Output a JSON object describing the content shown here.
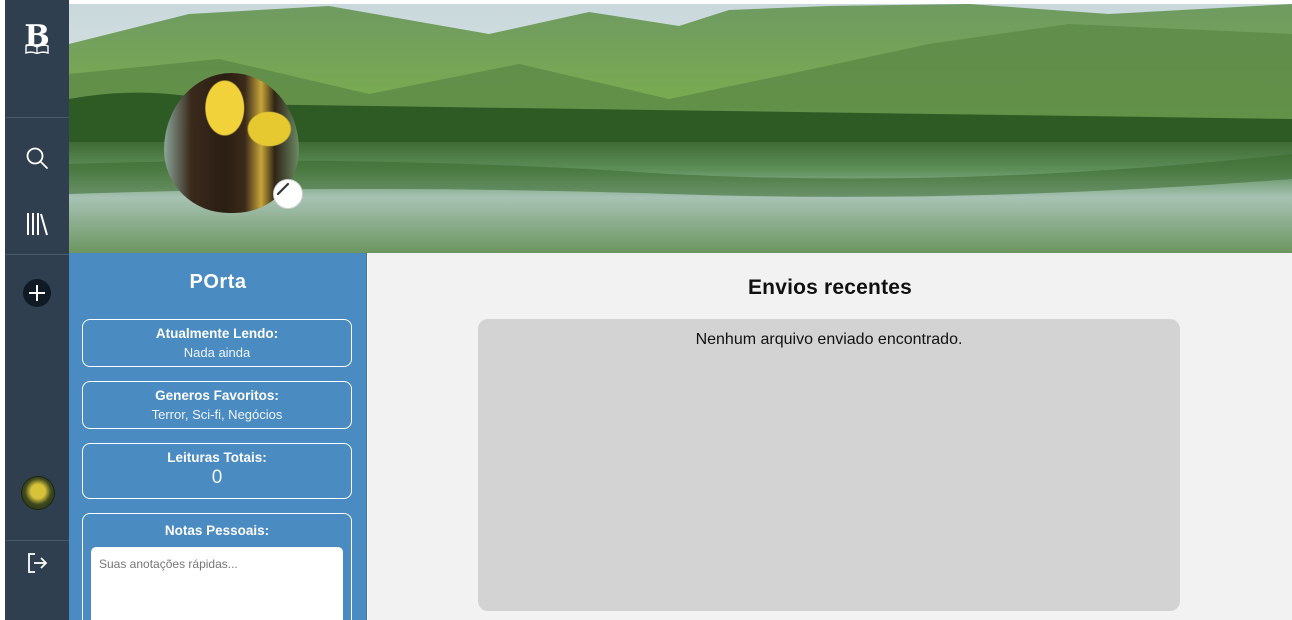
{
  "app": {
    "logo_letter": "B"
  },
  "nav": {
    "items": [
      {
        "icon": "search-icon"
      },
      {
        "icon": "library-icon"
      },
      {
        "icon": "add-icon"
      }
    ],
    "logout_icon": "logout-icon"
  },
  "profile": {
    "username": "POrta",
    "cards": {
      "reading": {
        "label": "Atualmente Lendo:",
        "value": "Nada ainda"
      },
      "genres": {
        "label": "Generos Favoritos:",
        "value": "Terror, Sci-fi, Negócios"
      },
      "total": {
        "label": "Leituras Totais:",
        "value": "0"
      }
    },
    "notes": {
      "label": "Notas Pessoais:",
      "placeholder": "Suas anotações rápidas..."
    }
  },
  "main": {
    "title": "Envios recentes",
    "empty_message": "Nenhum arquivo enviado encontrado."
  },
  "colors": {
    "rail_bg": "#2f3f4f",
    "profile_panel_bg": "#4a8bc2",
    "main_bg": "#f2f2f2",
    "uploads_box_bg": "#d3d3d3"
  }
}
